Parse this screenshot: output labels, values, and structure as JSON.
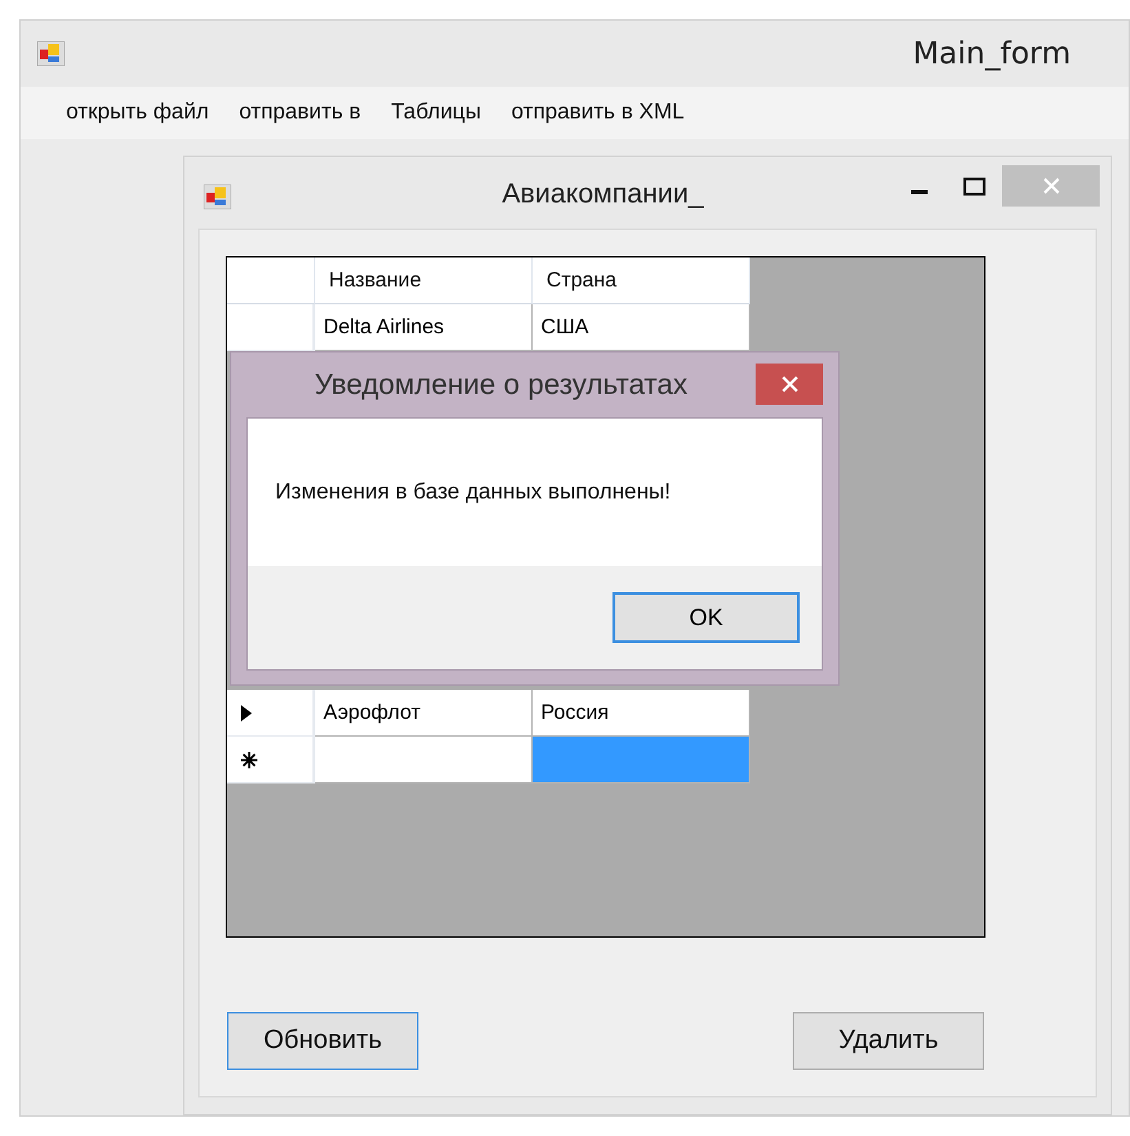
{
  "window": {
    "title": "Main_form"
  },
  "menu": [
    "открыть файл",
    "отправить в",
    "Таблицы",
    "отправить в XML"
  ],
  "child_window": {
    "title": "Авиакомпании_",
    "table": {
      "columns": [
        "Название",
        "Страна"
      ],
      "rows": [
        {
          "kind": "normal",
          "cells": [
            {
              "text": "Delta Airlines",
              "selected": false
            },
            {
              "text": "США",
              "selected": false
            }
          ]
        },
        {
          "kind": "current",
          "cells": [
            {
              "text": "Аэрофлот",
              "selected": false
            },
            {
              "text": "Россия",
              "selected": false
            }
          ]
        },
        {
          "kind": "new",
          "cells": [
            {
              "selected": false
            },
            {
              "selected": true
            }
          ]
        }
      ]
    },
    "buttons": [
      "Обновить",
      "Удалить"
    ]
  },
  "dialog": {
    "title": "Уведомление о результатах",
    "message": "Изменения в базе данных выполнены!",
    "button": "OK"
  }
}
